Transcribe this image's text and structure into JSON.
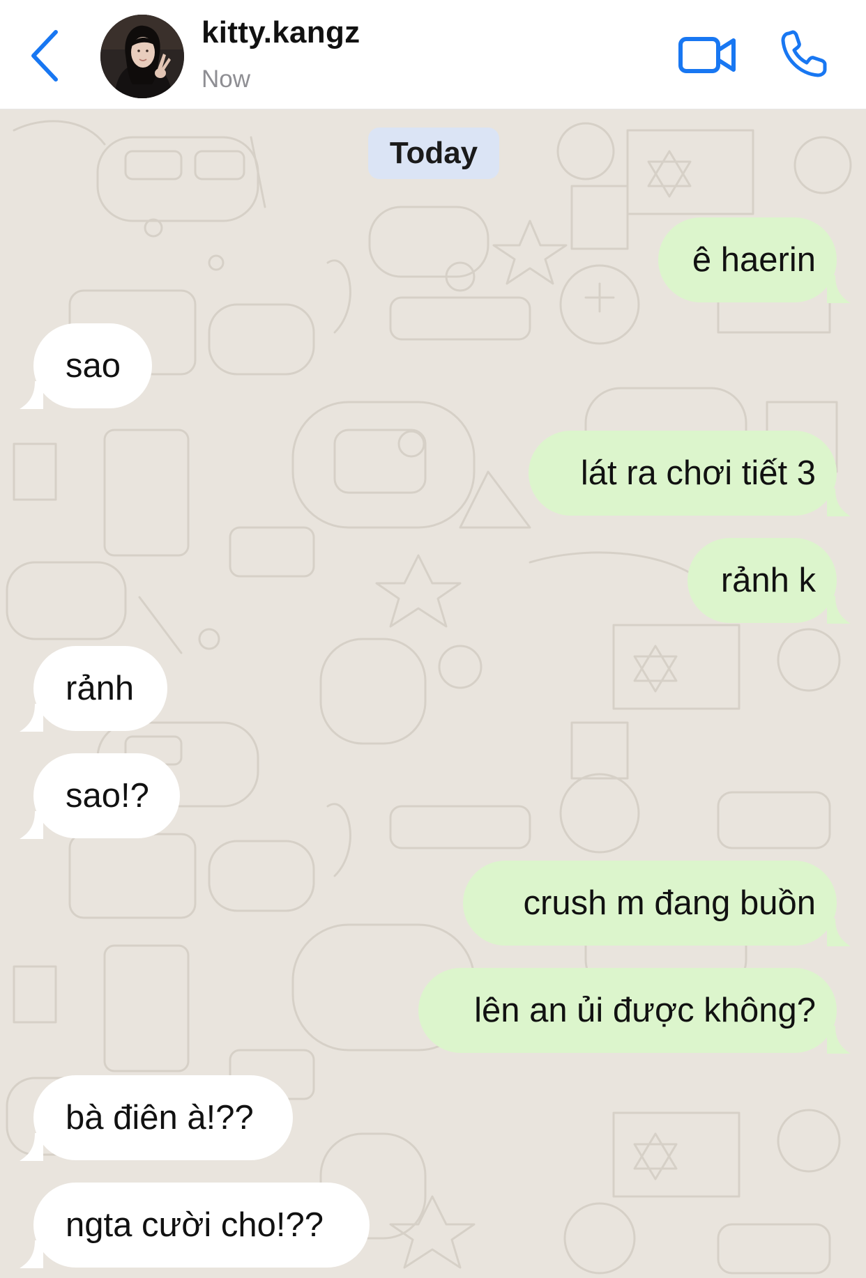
{
  "header": {
    "contact_name": "kitty.kangz",
    "status": "Now",
    "icons": {
      "back": "chevron-left-icon",
      "video": "video-camera-icon",
      "call": "phone-icon"
    },
    "accent_color": "#1877f2"
  },
  "chat": {
    "date_separator": "Today",
    "messages": [
      {
        "direction": "out",
        "text": "ê haerin"
      },
      {
        "direction": "in",
        "text": "sao"
      },
      {
        "direction": "out",
        "text": "lát ra chơi tiết 3"
      },
      {
        "direction": "out",
        "text": "rảnh k"
      },
      {
        "direction": "in",
        "text": "rảnh"
      },
      {
        "direction": "in",
        "text": "sao!?"
      },
      {
        "direction": "out",
        "text": "crush m đang buồn"
      },
      {
        "direction": "out",
        "text": "lên an ủi được không?"
      },
      {
        "direction": "in",
        "text": "bà điên à!??"
      },
      {
        "direction": "in",
        "text": "ngta cười cho!??"
      }
    ],
    "colors": {
      "outgoing_bubble": "#dcf5cc",
      "incoming_bubble": "#ffffff",
      "date_pill": "#dbe4f5",
      "wallpaper": "#e9e4dd"
    }
  }
}
